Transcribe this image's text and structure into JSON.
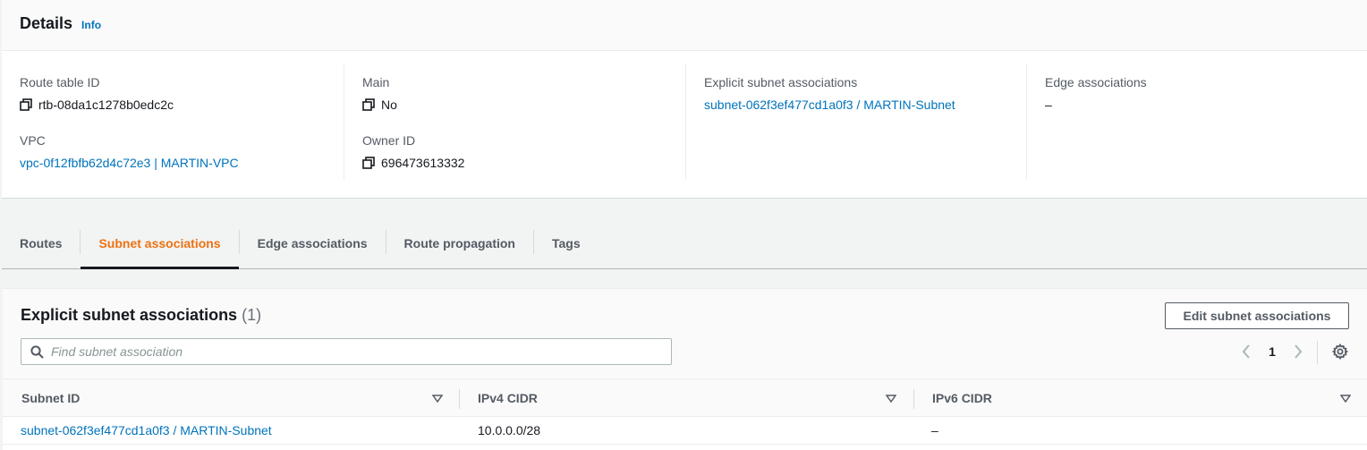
{
  "details": {
    "title": "Details",
    "info_label": "Info",
    "route_table_id": {
      "label": "Route table ID",
      "value": "rtb-08da1c1278b0edc2c"
    },
    "vpc": {
      "label": "VPC",
      "value": "vpc-0f12fbfb62d4c72e3 | MARTIN-VPC"
    },
    "main": {
      "label": "Main",
      "value": "No"
    },
    "owner_id": {
      "label": "Owner ID",
      "value": "696473613332"
    },
    "explicit_subnet_associations": {
      "label": "Explicit subnet associations",
      "value": "subnet-062f3ef477cd1a0f3 / MARTIN-Subnet"
    },
    "edge_associations": {
      "label": "Edge associations",
      "value": "–"
    }
  },
  "tabs": [
    {
      "label": "Routes",
      "active": false
    },
    {
      "label": "Subnet associations",
      "active": true
    },
    {
      "label": "Edge associations",
      "active": false
    },
    {
      "label": "Route propagation",
      "active": false
    },
    {
      "label": "Tags",
      "active": false
    }
  ],
  "panel": {
    "title": "Explicit subnet associations",
    "count": "(1)",
    "edit_button_label": "Edit subnet associations",
    "search_placeholder": "Find subnet association",
    "search_value": "",
    "current_page": "1"
  },
  "table": {
    "columns": [
      "Subnet ID",
      "IPv4 CIDR",
      "IPv6 CIDR"
    ],
    "rows": [
      {
        "subnet_id": "subnet-062f3ef477cd1a0f3 / MARTIN-Subnet",
        "ipv4_cidr": "10.0.0.0/28",
        "ipv6_cidr": "–"
      }
    ]
  },
  "colors": {
    "link": "#0073bb",
    "active_tab": "#ec7211",
    "text": "#16191f",
    "muted": "#545b64"
  },
  "icons": {
    "copy": "copy-icon",
    "search": "search-icon",
    "prev": "chevron-left-icon",
    "next": "chevron-right-icon",
    "settings": "gear-icon",
    "sort": "caret-down-icon"
  }
}
